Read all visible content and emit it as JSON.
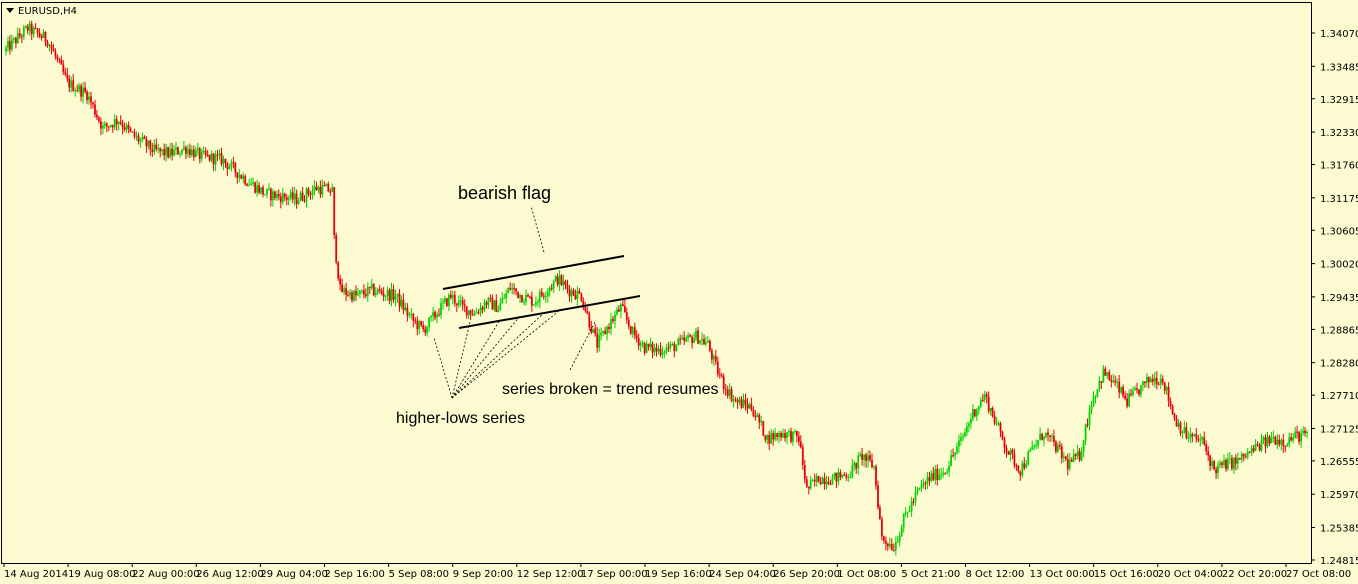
{
  "chart_data": {
    "type": "candlestick",
    "title": "EURUSD,H4",
    "colors": {
      "background": "#fcfad0",
      "up": "#00d400",
      "down": "#e8000b",
      "axis": "#000000",
      "annotation": "#000000"
    },
    "y_ticks": [
      "1.34070",
      "1.33485",
      "1.32915",
      "1.32330",
      "1.31760",
      "1.31175",
      "1.30605",
      "1.30020",
      "1.29435",
      "1.28865",
      "1.28280",
      "1.27710",
      "1.27125",
      "1.26555",
      "1.25970",
      "1.25385",
      "1.24815"
    ],
    "ylim": [
      1.247,
      1.3435
    ],
    "x_ticks": [
      "14 Aug 2014",
      "19 Aug 08:00",
      "22 Aug 00:00",
      "26 Aug 12:00",
      "29 Aug 04:00",
      "2 Sep 16:00",
      "5 Sep 08:00",
      "9 Sep 20:00",
      "12 Sep 12:00",
      "17 Sep 00:00",
      "19 Sep 16:00",
      "24 Sep 04:00",
      "26 Sep 20:00",
      "1 Oct 08:00",
      "5 Oct 21:00",
      "8 Oct 12:00",
      "13 Oct 00:00",
      "15 Oct 16:00",
      "20 Oct 04:00",
      "22 Oct 20:00",
      "27 Oct 08:00"
    ],
    "close_path": [
      [
        0,
        1.3375
      ],
      [
        12,
        1.3415
      ],
      [
        22,
        1.3395
      ],
      [
        32,
        1.332
      ],
      [
        42,
        1.33
      ],
      [
        50,
        1.324
      ],
      [
        58,
        1.3255
      ],
      [
        64,
        1.323
      ],
      [
        76,
        1.32
      ],
      [
        84,
        1.3195
      ],
      [
        92,
        1.3205
      ],
      [
        100,
        1.319
      ],
      [
        110,
        1.3185
      ],
      [
        124,
        1.3145
      ],
      [
        132,
        1.3125
      ],
      [
        140,
        1.312
      ],
      [
        148,
        1.3115
      ],
      [
        158,
        1.3135
      ],
      [
        166,
        1.313
      ],
      [
        166,
        1.3075
      ],
      [
        170,
        1.2955
      ],
      [
        178,
        1.2945
      ],
      [
        186,
        1.2955
      ],
      [
        198,
        1.2945
      ],
      [
        206,
        1.2905
      ],
      [
        212,
        1.2885
      ],
      [
        220,
        1.292
      ],
      [
        226,
        1.2945
      ],
      [
        232,
        1.2925
      ],
      [
        238,
        1.2915
      ],
      [
        244,
        1.2935
      ],
      [
        250,
        1.2925
      ],
      [
        256,
        1.296
      ],
      [
        262,
        1.2945
      ],
      [
        268,
        1.2935
      ],
      [
        274,
        1.2955
      ],
      [
        280,
        1.2975
      ],
      [
        286,
        1.2955
      ],
      [
        292,
        1.2945
      ],
      [
        296,
        1.29
      ],
      [
        300,
        1.286
      ],
      [
        306,
        1.2895
      ],
      [
        312,
        1.2925
      ],
      [
        318,
        1.288
      ],
      [
        324,
        1.2855
      ],
      [
        330,
        1.285
      ],
      [
        338,
        1.2855
      ],
      [
        344,
        1.2865
      ],
      [
        350,
        1.2875
      ],
      [
        356,
        1.286
      ],
      [
        360,
        1.282
      ],
      [
        364,
        1.279
      ],
      [
        370,
        1.276
      ],
      [
        378,
        1.275
      ],
      [
        386,
        1.2695
      ],
      [
        394,
        1.2705
      ],
      [
        402,
        1.2695
      ],
      [
        406,
        1.2605
      ],
      [
        412,
        1.2625
      ],
      [
        420,
        1.2625
      ],
      [
        428,
        1.2635
      ],
      [
        434,
        1.2665
      ],
      [
        440,
        1.2645
      ],
      [
        444,
        1.252
      ],
      [
        450,
        1.2505
      ],
      [
        456,
        1.256
      ],
      [
        462,
        1.26
      ],
      [
        468,
        1.2625
      ],
      [
        476,
        1.264
      ],
      [
        484,
        1.269
      ],
      [
        490,
        1.274
      ],
      [
        496,
        1.277
      ],
      [
        502,
        1.272
      ],
      [
        508,
        1.267
      ],
      [
        514,
        1.264
      ],
      [
        520,
        1.2675
      ],
      [
        526,
        1.2705
      ],
      [
        532,
        1.268
      ],
      [
        538,
        1.265
      ],
      [
        544,
        1.2665
      ],
      [
        550,
        1.276
      ],
      [
        556,
        1.281
      ],
      [
        562,
        1.279
      ],
      [
        568,
        1.276
      ],
      [
        574,
        1.278
      ],
      [
        580,
        1.28
      ],
      [
        586,
        1.28
      ],
      [
        592,
        1.273
      ],
      [
        598,
        1.27
      ],
      [
        606,
        1.269
      ],
      [
        612,
        1.264
      ],
      [
        618,
        1.265
      ],
      [
        624,
        1.2655
      ],
      [
        630,
        1.267
      ],
      [
        636,
        1.2685
      ],
      [
        642,
        1.2695
      ],
      [
        648,
        1.269
      ],
      [
        654,
        1.27
      ]
    ],
    "annotations": {
      "bearish_flag": "bearish flag",
      "higher_lows": "higher-lows series",
      "series_broken": "series broken = trend resumes"
    }
  }
}
